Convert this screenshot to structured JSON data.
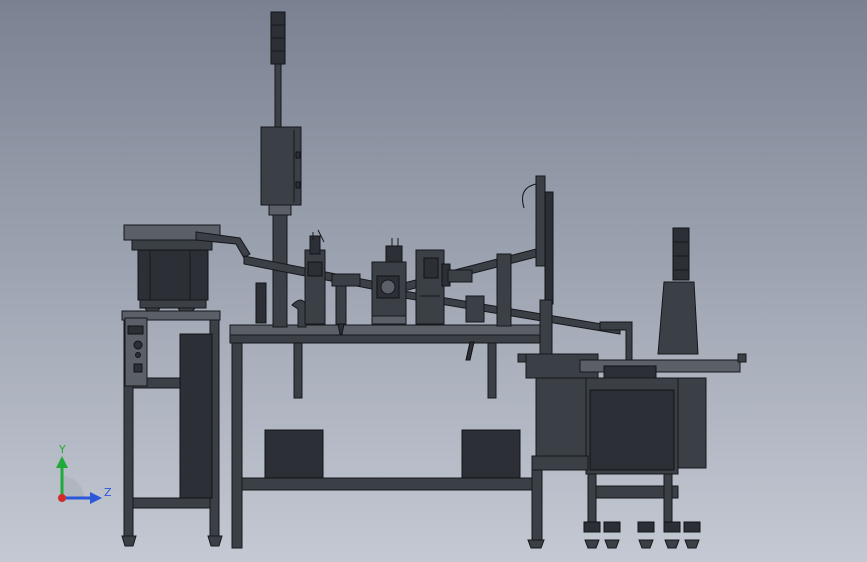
{
  "viewport": {
    "background_top": "#7a8292",
    "background_bottom": "#c4c9d3"
  },
  "model": {
    "body_color": "#3b3f46",
    "edge_color": "#16181c",
    "highlight_color": "#5a5f68"
  },
  "triad": {
    "y_label": "Y",
    "z_label": "Z",
    "y_color": "#1faa3a",
    "z_color": "#2a58d8",
    "origin_color": "#d42a2a"
  }
}
